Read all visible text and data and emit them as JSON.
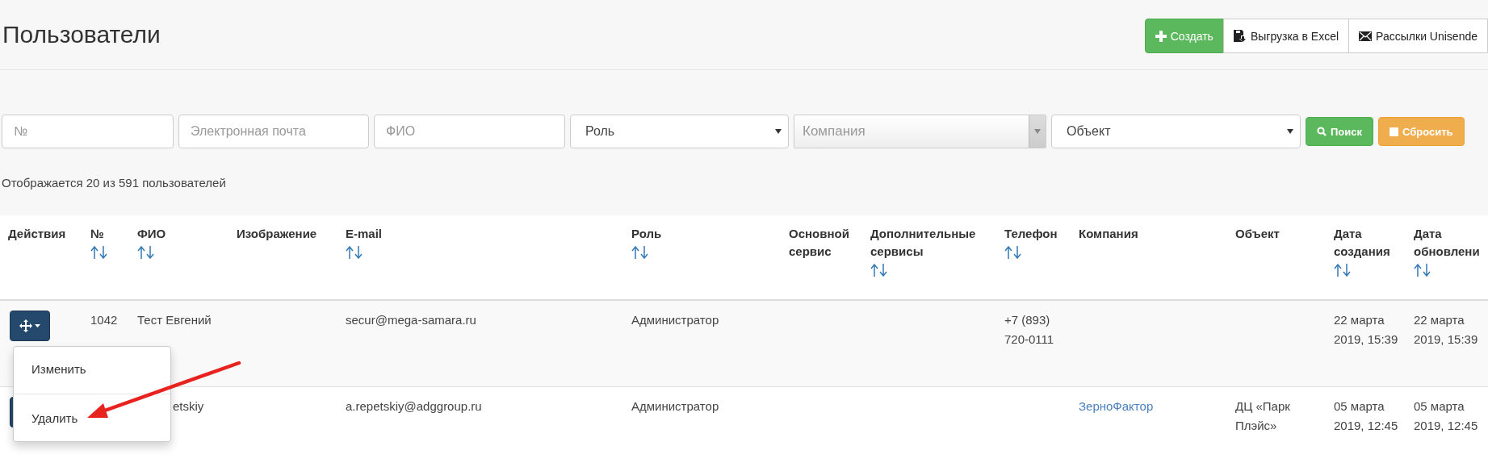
{
  "page": {
    "title": "Пользователи"
  },
  "toolbar": [
    {
      "kind": "create",
      "label": "Создать"
    },
    {
      "kind": "export",
      "label": "Выгрузка в Excel"
    },
    {
      "kind": "mail",
      "label": "Рассылки Unisende"
    }
  ],
  "filters": [
    {
      "kind": "text",
      "placeholder": "№"
    },
    {
      "kind": "text",
      "placeholder": "Электронная почта"
    },
    {
      "kind": "text",
      "placeholder": "ФИО"
    },
    {
      "kind": "select",
      "value": "Роль"
    },
    {
      "kind": "combo",
      "placeholder": "Компания"
    },
    {
      "kind": "select",
      "value": "Объект"
    }
  ],
  "filter_buttons": [
    {
      "kind": "search",
      "label": "Поиск"
    },
    {
      "kind": "reset",
      "label": "Сбросить"
    }
  ],
  "summary": "Отображается 20 из 591 пользователей",
  "table": {
    "columns": [
      {
        "label": "Действия",
        "sortable": false
      },
      {
        "label": "№",
        "sortable": true
      },
      {
        "label": "ФИО",
        "sortable": true
      },
      {
        "label": "Изображение",
        "sortable": false
      },
      {
        "label": "E-mail",
        "sortable": true
      },
      {
        "label": "Роль",
        "sortable": true
      },
      {
        "label": "Основной сервис",
        "sortable": false
      },
      {
        "label": "Дополнительные сервисы",
        "sortable": true
      },
      {
        "label": "Телефон",
        "sortable": true
      },
      {
        "label": "Компания",
        "sortable": false
      },
      {
        "label": "Объект",
        "sortable": false
      },
      {
        "label": "Дата создания",
        "sortable": true
      },
      {
        "label": "Дата обновлени",
        "sortable": true
      }
    ],
    "rows": [
      {
        "actions": true,
        "menu_open": true,
        "number": "1042",
        "name": "Тест Евгений",
        "email": "secur@mega-samara.ru",
        "role": "Администратор",
        "phone": "+7 (893) 720-0111",
        "created": "22 марта 2019, 15:39",
        "updated": "22 марта 2019, 15:39"
      },
      {
        "actions": true,
        "menu_open": false,
        "name": "etskiy",
        "email": "a.repetskiy@adggroup.ru",
        "role": "Администратор",
        "company": "ЗерноФактор",
        "object": "ДЦ «Парк Плэйс»",
        "created": "05 марта 2019, 12:45",
        "updated": "05 марта 2019, 12:45"
      }
    ]
  },
  "row_menu": {
    "items": [
      "Изменить",
      "Удалить"
    ]
  }
}
